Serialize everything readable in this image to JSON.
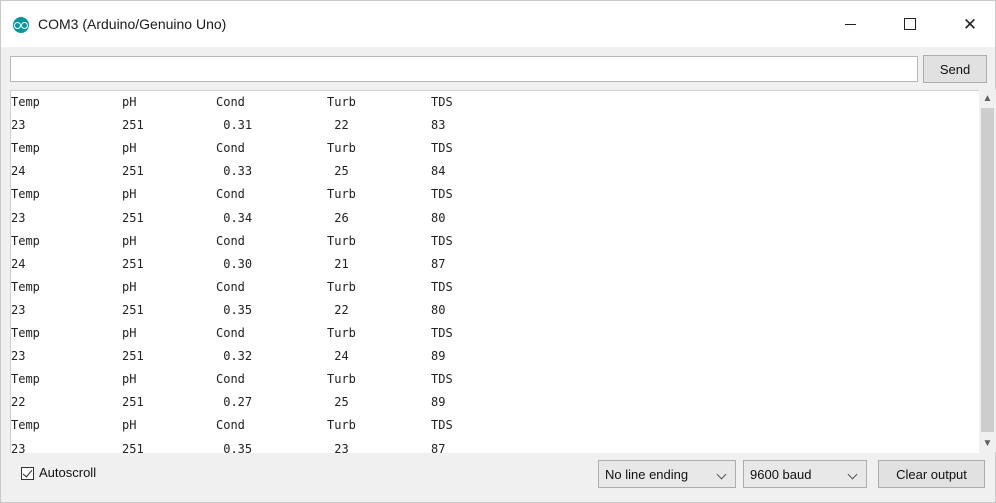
{
  "window": {
    "title": "COM3 (Arduino/Genuino Uno)",
    "app_icon": "arduino-icon",
    "controls": [
      "minimize-icon",
      "maximize-icon",
      "close-icon"
    ]
  },
  "input_row": {
    "value": "",
    "send_label": "Send"
  },
  "serial_output": {
    "lines": [
      [
        "Temp",
        "pH",
        "Cond",
        "Turb",
        "TDS"
      ],
      [
        "23",
        "251",
        " 0.31",
        " 22",
        "83"
      ],
      [
        "Temp",
        "pH",
        "Cond",
        "Turb",
        "TDS"
      ],
      [
        "24",
        "251",
        " 0.33",
        " 25",
        "84"
      ],
      [
        "Temp",
        "pH",
        "Cond",
        "Turb",
        "TDS"
      ],
      [
        "23",
        "251",
        " 0.34",
        " 26",
        "80"
      ],
      [
        "Temp",
        "pH",
        "Cond",
        "Turb",
        "TDS"
      ],
      [
        "24",
        "251",
        " 0.30",
        " 21",
        "87"
      ],
      [
        "Temp",
        "pH",
        "Cond",
        "Turb",
        "TDS"
      ],
      [
        "23",
        "251",
        " 0.35",
        " 22",
        "80"
      ],
      [
        "Temp",
        "pH",
        "Cond",
        "Turb",
        "TDS"
      ],
      [
        "23",
        "251",
        " 0.32",
        " 24",
        "89"
      ],
      [
        "Temp",
        "pH",
        "Cond",
        "Turb",
        "TDS"
      ],
      [
        "22",
        "251",
        " 0.27",
        " 25",
        "89"
      ],
      [
        "Temp",
        "pH",
        "Cond",
        "Turb",
        "TDS"
      ],
      [
        "23",
        "251",
        " 0.35",
        " 23",
        "87"
      ]
    ]
  },
  "bottom_bar": {
    "autoscroll_label": "Autoscroll",
    "autoscroll_checked": true,
    "line_ending": "No line ending",
    "baud_rate": "9600 baud",
    "clear_label": "Clear output"
  },
  "colors": {
    "arduino_teal": "#00979c"
  }
}
